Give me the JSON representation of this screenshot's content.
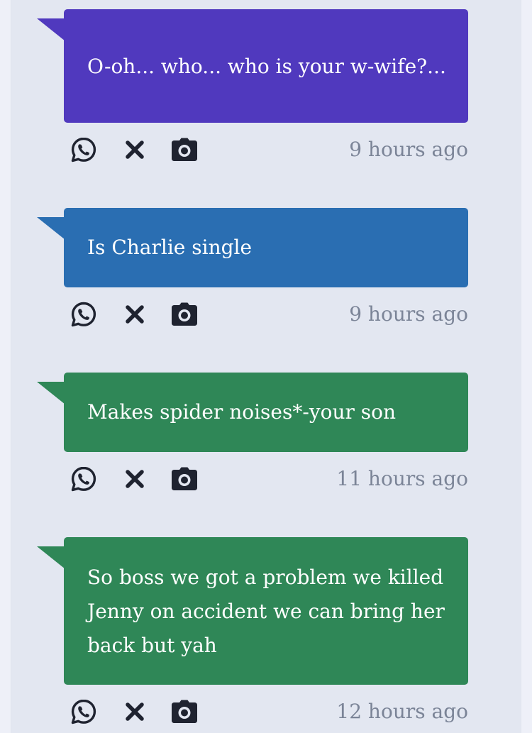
{
  "messages": [
    {
      "text": "O-oh... who... who is your w-wife?...",
      "time": "9 hours ago",
      "color": "#5039be"
    },
    {
      "text": "Is Charlie single",
      "time": "9 hours ago",
      "color": "#2a6eb2"
    },
    {
      "text": "Makes spider noises*-your son",
      "time": "11 hours ago",
      "color": "#2f8757"
    },
    {
      "text": "So boss we got a problem we killed Jenny on accident we can bring her back but yah",
      "time": "12 hours ago",
      "color": "#2f8757"
    }
  ],
  "icons": {
    "share_whatsapp": "whatsapp-icon",
    "dismiss": "close-icon",
    "screenshot": "camera-icon"
  },
  "colors": {
    "background": "#e3e7f1",
    "timestamp": "#7b8497",
    "icon": "#1f2330"
  }
}
